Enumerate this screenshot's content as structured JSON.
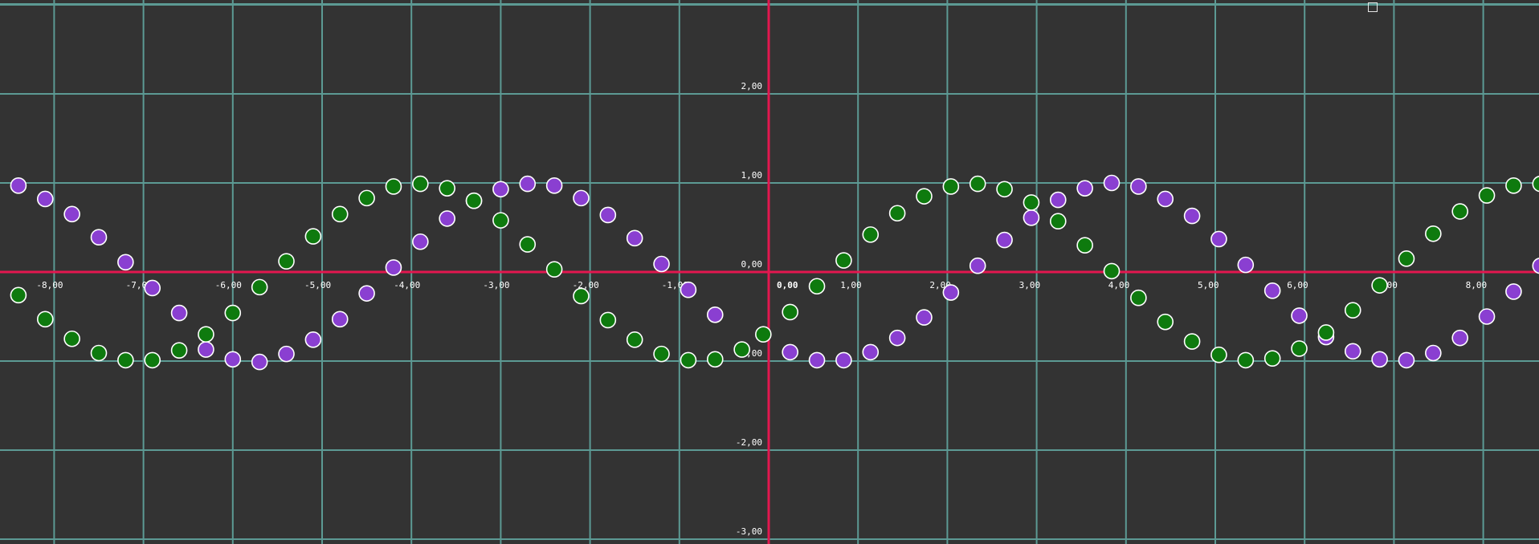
{
  "colors": {
    "background": "#333333",
    "grid": "#5c9a94",
    "axis": "#e3174f",
    "label": "#ffffff",
    "point_outline": "#ffffff"
  },
  "corner_control": {
    "icon": "square-outline-icon"
  },
  "chart_data": {
    "type": "scatter",
    "title": "",
    "xlabel": "",
    "ylabel": "",
    "xlim": [
      -8.6,
      8.6
    ],
    "ylim": [
      -3.0,
      3.0
    ],
    "grid": true,
    "x_ticks": [
      {
        "value": -8,
        "label": "-8,00"
      },
      {
        "value": -7,
        "label": "-7,00"
      },
      {
        "value": -6,
        "label": "-6,00"
      },
      {
        "value": -5,
        "label": "-5,00"
      },
      {
        "value": -4,
        "label": "-4,00"
      },
      {
        "value": -3,
        "label": "-3,00"
      },
      {
        "value": -2,
        "label": "-2,00"
      },
      {
        "value": -1,
        "label": "-1,00"
      },
      {
        "value": 1,
        "label": "1,00"
      },
      {
        "value": 2,
        "label": "2,00"
      },
      {
        "value": 3,
        "label": "3,00"
      },
      {
        "value": 4,
        "label": "4,00"
      },
      {
        "value": 5,
        "label": "5,00"
      },
      {
        "value": 6,
        "label": "6,00"
      },
      {
        "value": 7,
        "label": "7,00"
      },
      {
        "value": 8,
        "label": "8,00"
      }
    ],
    "y_ticks": [
      {
        "value": 2,
        "label": "2,00"
      },
      {
        "value": 1,
        "label": "1,00"
      },
      {
        "value": 0,
        "label": "0,00"
      },
      {
        "value": -1,
        "label": "-1,00"
      },
      {
        "value": -2,
        "label": "-2,00"
      },
      {
        "value": -3,
        "label": "-3,00"
      }
    ],
    "origin_label": "0,00",
    "series": [
      {
        "color": "#8a3fd1",
        "points": [
          {
            "x": -8.4,
            "y": 0.97
          },
          {
            "x": -8.1,
            "y": 0.82
          },
          {
            "x": -7.8,
            "y": 0.65
          },
          {
            "x": -7.5,
            "y": 0.39
          },
          {
            "x": -7.2,
            "y": 0.11
          },
          {
            "x": -6.9,
            "y": -0.18
          },
          {
            "x": -6.6,
            "y": -0.46
          },
          {
            "x": -6.3,
            "y": -0.87
          },
          {
            "x": -6.0,
            "y": -0.98
          },
          {
            "x": -5.7,
            "y": -1.01
          },
          {
            "x": -5.4,
            "y": -0.92
          },
          {
            "x": -5.1,
            "y": -0.76
          },
          {
            "x": -4.8,
            "y": -0.53
          },
          {
            "x": -4.5,
            "y": -0.24
          },
          {
            "x": -4.2,
            "y": 0.05
          },
          {
            "x": -3.9,
            "y": 0.34
          },
          {
            "x": -3.6,
            "y": 0.6
          },
          {
            "x": -3.3,
            "y": 0.8
          },
          {
            "x": -3.0,
            "y": 0.93
          },
          {
            "x": -2.7,
            "y": 0.99
          },
          {
            "x": -2.4,
            "y": 0.97
          },
          {
            "x": -2.1,
            "y": 0.83
          },
          {
            "x": -1.8,
            "y": 0.64
          },
          {
            "x": -1.5,
            "y": 0.38
          },
          {
            "x": -1.2,
            "y": 0.09
          },
          {
            "x": -0.9,
            "y": -0.2
          },
          {
            "x": -0.6,
            "y": -0.48
          },
          {
            "x": 0.24,
            "y": -0.9
          },
          {
            "x": 0.54,
            "y": -0.99
          },
          {
            "x": 0.84,
            "y": -0.99
          },
          {
            "x": 1.14,
            "y": -0.9
          },
          {
            "x": 1.44,
            "y": -0.74
          },
          {
            "x": 1.74,
            "y": -0.51
          },
          {
            "x": 2.04,
            "y": -0.23
          },
          {
            "x": 2.34,
            "y": 0.07
          },
          {
            "x": 2.64,
            "y": 0.36
          },
          {
            "x": 2.94,
            "y": 0.61
          },
          {
            "x": 3.24,
            "y": 0.81
          },
          {
            "x": 3.54,
            "y": 0.94
          },
          {
            "x": 3.84,
            "y": 1.0
          },
          {
            "x": 4.14,
            "y": 0.96
          },
          {
            "x": 4.44,
            "y": 0.82
          },
          {
            "x": 4.74,
            "y": 0.63
          },
          {
            "x": 5.04,
            "y": 0.37
          },
          {
            "x": 5.34,
            "y": 0.08
          },
          {
            "x": 5.64,
            "y": -0.21
          },
          {
            "x": 5.94,
            "y": -0.49
          },
          {
            "x": 6.24,
            "y": -0.73
          },
          {
            "x": 6.54,
            "y": -0.89
          },
          {
            "x": 6.84,
            "y": -0.98
          },
          {
            "x": 7.14,
            "y": -0.99
          },
          {
            "x": 7.44,
            "y": -0.91
          },
          {
            "x": 7.74,
            "y": -0.74
          },
          {
            "x": 8.04,
            "y": -0.5
          },
          {
            "x": 8.34,
            "y": -0.22
          },
          {
            "x": 8.64,
            "y": 0.07
          }
        ]
      },
      {
        "color": "#0e7a0e",
        "points": [
          {
            "x": -8.4,
            "y": -0.26
          },
          {
            "x": -8.1,
            "y": -0.53
          },
          {
            "x": -7.8,
            "y": -0.75
          },
          {
            "x": -7.5,
            "y": -0.91
          },
          {
            "x": -7.2,
            "y": -0.99
          },
          {
            "x": -6.9,
            "y": -0.99
          },
          {
            "x": -6.6,
            "y": -0.88
          },
          {
            "x": -6.3,
            "y": -0.7
          },
          {
            "x": -6.0,
            "y": -0.46
          },
          {
            "x": -5.7,
            "y": -0.17
          },
          {
            "x": -5.4,
            "y": 0.12
          },
          {
            "x": -5.1,
            "y": 0.4
          },
          {
            "x": -4.8,
            "y": 0.65
          },
          {
            "x": -4.5,
            "y": 0.83
          },
          {
            "x": -4.2,
            "y": 0.96
          },
          {
            "x": -3.9,
            "y": 0.99
          },
          {
            "x": -3.6,
            "y": 0.94
          },
          {
            "x": -3.3,
            "y": 0.8
          },
          {
            "x": -3.0,
            "y": 0.58
          },
          {
            "x": -2.7,
            "y": 0.31
          },
          {
            "x": -2.4,
            "y": 0.03
          },
          {
            "x": -2.1,
            "y": -0.27
          },
          {
            "x": -1.8,
            "y": -0.54
          },
          {
            "x": -1.5,
            "y": -0.76
          },
          {
            "x": -1.2,
            "y": -0.92
          },
          {
            "x": -0.9,
            "y": -0.99
          },
          {
            "x": -0.6,
            "y": -0.98
          },
          {
            "x": -0.3,
            "y": -0.87
          },
          {
            "x": -0.06,
            "y": -0.7
          },
          {
            "x": 0.24,
            "y": -0.45
          },
          {
            "x": 0.54,
            "y": -0.16
          },
          {
            "x": 0.84,
            "y": 0.13
          },
          {
            "x": 1.14,
            "y": 0.42
          },
          {
            "x": 1.44,
            "y": 0.66
          },
          {
            "x": 1.74,
            "y": 0.85
          },
          {
            "x": 2.04,
            "y": 0.96
          },
          {
            "x": 2.34,
            "y": 0.99
          },
          {
            "x": 2.64,
            "y": 0.93
          },
          {
            "x": 2.94,
            "y": 0.78
          },
          {
            "x": 3.24,
            "y": 0.57
          },
          {
            "x": 3.54,
            "y": 0.3
          },
          {
            "x": 3.84,
            "y": 0.01
          },
          {
            "x": 4.14,
            "y": -0.29
          },
          {
            "x": 4.44,
            "y": -0.56
          },
          {
            "x": 4.74,
            "y": -0.78
          },
          {
            "x": 5.04,
            "y": -0.93
          },
          {
            "x": 5.34,
            "y": -0.99
          },
          {
            "x": 5.64,
            "y": -0.97
          },
          {
            "x": 5.94,
            "y": -0.86
          },
          {
            "x": 6.24,
            "y": -0.68
          },
          {
            "x": 6.54,
            "y": -0.43
          },
          {
            "x": 6.84,
            "y": -0.15
          },
          {
            "x": 7.14,
            "y": 0.15
          },
          {
            "x": 7.44,
            "y": 0.43
          },
          {
            "x": 7.74,
            "y": 0.68
          },
          {
            "x": 8.04,
            "y": 0.86
          },
          {
            "x": 8.34,
            "y": 0.97
          },
          {
            "x": 8.64,
            "y": 0.99
          }
        ]
      }
    ]
  }
}
